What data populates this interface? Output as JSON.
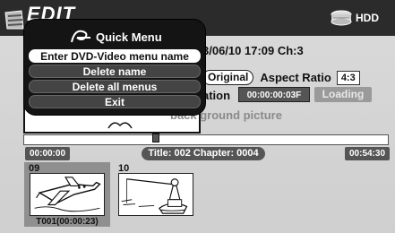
{
  "header": {
    "title": "EDIT",
    "storage_label": "HDD"
  },
  "info": {
    "date_channel": "3/06/10 17:09 Ch:3",
    "original_label": "Original",
    "aspect_label": "Aspect Ratio",
    "aspect_value": "4:3",
    "duration_label": "ation",
    "duration_value": "00:00:00:03F",
    "loading_label": "Loading",
    "background_text": "back ground picture"
  },
  "timeline": {
    "start_time": "00:00:00",
    "title_chapter": "Title: 002  Chapter: 0004",
    "end_time": "00:54:30"
  },
  "thumbnails": [
    {
      "number": "09",
      "caption": "T001(00:00:23)",
      "selected": true
    },
    {
      "number": "10",
      "caption": "",
      "selected": false
    }
  ],
  "quick_menu": {
    "title": "Quick Menu",
    "items": [
      {
        "label": "Enter DVD-Video menu name",
        "selected": true
      },
      {
        "label": "Delete name",
        "selected": false
      },
      {
        "label": "Delete all menus",
        "selected": false
      },
      {
        "label": "Exit",
        "selected": false
      }
    ]
  },
  "colors": {
    "header_bg": "#2b2b2b",
    "menu_bg": "#141414",
    "menu_item": "#444444",
    "selected_item": "#ffffff",
    "panel_bg": "#d6d6d6"
  },
  "icons": {
    "left": "film-reel-icon",
    "storage": "hdd-icon",
    "menu": "quick-menu-icon"
  }
}
